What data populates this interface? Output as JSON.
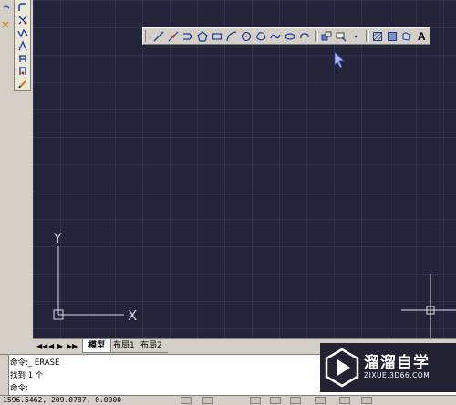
{
  "toolbar_draw": {
    "tools": [
      {
        "icon": "line-icon"
      },
      {
        "icon": "construction-line-icon"
      },
      {
        "icon": "polyline-icon"
      },
      {
        "icon": "polygon-icon"
      },
      {
        "icon": "rectangle-icon"
      },
      {
        "icon": "arc-icon"
      },
      {
        "icon": "circle-icon"
      },
      {
        "icon": "revision-cloud-icon"
      },
      {
        "icon": "spline-icon"
      },
      {
        "icon": "ellipse-icon"
      },
      {
        "icon": "ellipse-arc-icon"
      },
      {
        "icon": "insert-block-icon"
      },
      {
        "icon": "make-block-icon"
      },
      {
        "icon": "point-icon"
      },
      {
        "icon": "hatch-icon"
      },
      {
        "icon": "gradient-icon"
      },
      {
        "icon": "region-icon"
      },
      {
        "icon": "multiline-text-icon"
      }
    ],
    "text_tool_label": "A"
  },
  "left_toolbar": {
    "tools": [
      {
        "icon": "fillet-icon"
      },
      {
        "icon": "explode-icon"
      },
      {
        "icon": "trim-icon"
      },
      {
        "icon": "stretch-icon"
      },
      {
        "icon": "break-icon"
      },
      {
        "icon": "join-icon"
      },
      {
        "icon": "edit-pencil-icon"
      }
    ]
  },
  "canvas": {
    "background_color": "#232339",
    "ucs_y_label": "Y",
    "ucs_x_label": "X"
  },
  "tabs": {
    "nav_arrows": [
      "◀◀",
      "◀",
      "▶",
      "▶▶"
    ],
    "items": [
      {
        "label": "模型",
        "active": true
      },
      {
        "label": "布局1",
        "active": false
      },
      {
        "label": "布局2",
        "active": false
      }
    ]
  },
  "command": {
    "lines": [
      "命令:_ ERASE",
      "找到 1 个",
      "命令:"
    ]
  },
  "status": {
    "coordinates": "1596.5462, 209.0787, 0.0000"
  },
  "watermark": {
    "title": "溜溜自学",
    "url": "ZIXUE.3D66.COM"
  }
}
